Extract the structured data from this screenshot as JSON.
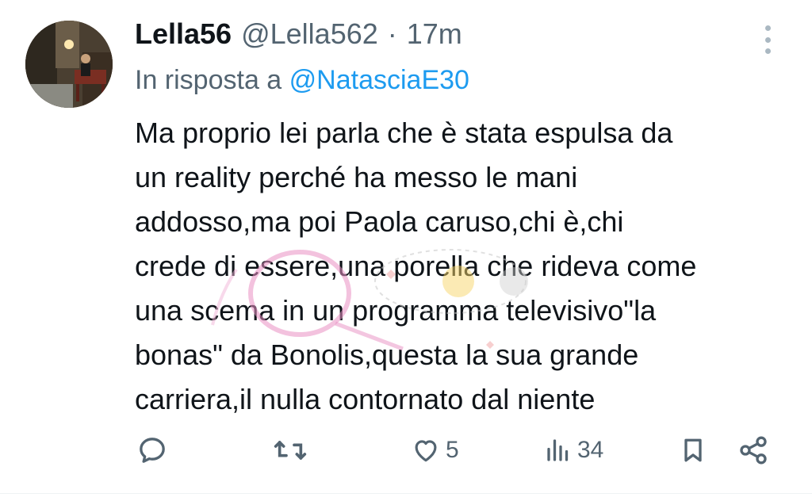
{
  "tweet": {
    "display_name": "Lella56",
    "handle": "@Lella562",
    "separator": "·",
    "time": "17m",
    "reply_prefix": "In risposta a",
    "reply_to": "@NatasciaE30",
    "body_lines": [
      "Ma proprio lei parla che è stata espulsa da",
      "un reality perché ha messo le mani",
      "addosso,ma poi Paola caruso,chi è,chi",
      "crede di essere,una porella che rideva come",
      "una scema in un programma televisivo\"la",
      "bonas\" da Bonolis,questa la sua grande",
      "carriera,il nulla contornato dal niente"
    ]
  },
  "actions": {
    "reply_icon": "comment-icon",
    "retweet_icon": "retweet-icon",
    "like_icon": "heart-icon",
    "like_count": "5",
    "views_icon": "views-bar-chart-icon",
    "views_count": "34",
    "bookmark_icon": "bookmark-icon",
    "share_icon": "share-icon"
  },
  "colors": {
    "text": "#0f1419",
    "secondary": "#536471",
    "link": "#1d9bf0"
  }
}
